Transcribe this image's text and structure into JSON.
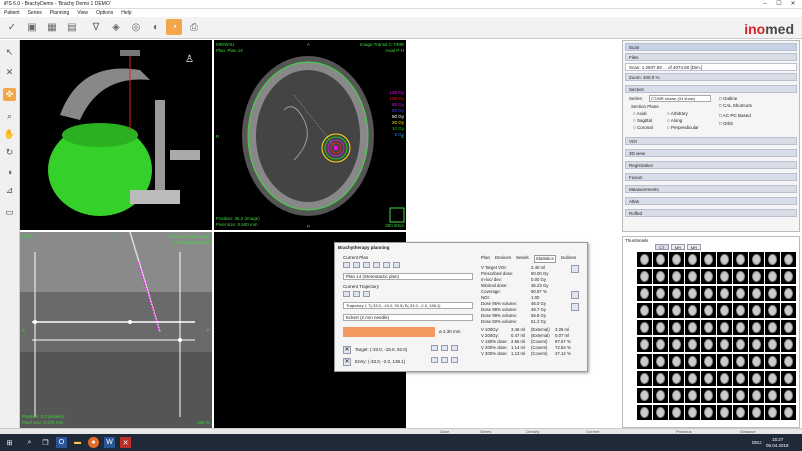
{
  "window": {
    "title": "iPS 6.0 - BrachyDemo - 'Brachy Demo 1 DEMO'"
  },
  "menu": [
    "Patient",
    "Series",
    "Planning",
    "View",
    "Options",
    "Help"
  ],
  "logo": {
    "part1": "ino",
    "part2": "med"
  },
  "views": {
    "axial": {
      "tl1": "MR/W4U",
      "tl2": "Plan: Plan 14",
      "tr1": "Image Transit C.T/MR",
      "tr2": "Axial P-H",
      "top_dir": "A",
      "bottom_dir": "P",
      "left_dir": "R",
      "right_dir": "L",
      "bl1": "Position: 35.2 (image)",
      "bl2": "Pixel size: 0.500 mm",
      "br": "250.0mm",
      "isodose": [
        "120 Gy",
        "100 Gy",
        "80 Gy",
        "60 Gy",
        "50 Gy",
        "20 Gy",
        "10 Gy",
        "5 Gy"
      ]
    },
    "sagittal": {
      "tl1": "CT/CT",
      "tl2": "",
      "tr1": "Screen Transit Angle",
      "tr2": "Left/Sagittal/Stack",
      "br": "400 %",
      "bl1": "Position: 0.0 (screen)",
      "bl2": "Pixel size: 0.375 mm",
      "top_dir": "S",
      "left_dir": "A",
      "right_dir": "P"
    }
  },
  "panel": {
    "rows": [
      "Files",
      "Scan: 1.2837.59 ... of 4074.60 [Dim.]",
      "Zoom: 400.0 %",
      "Section",
      "VOI",
      "3D view",
      "Registration",
      "Fusion",
      "Measurements",
      "Atlas",
      "Rolfed"
    ],
    "series_label": "Series:",
    "series_value": "CT/MR shown (31 show)",
    "section_plane": "Section Plane",
    "radios": [
      "Axial",
      "Sagittal",
      "Coronal",
      "Arbitrary",
      "Along",
      "Perpendicular"
    ],
    "checks": [
      "Outline",
      "CAL Shortcuts",
      "AC-PC Based",
      "Orbit"
    ]
  },
  "thumbs": {
    "title": "Thumbnails",
    "tabs": [
      "CT",
      "MR",
      "MR"
    ]
  },
  "dialog": {
    "title": "Brachytherapy planning",
    "current_plan": "Current Plan",
    "plan_value": "Plan 14 (Stereotactic plan)",
    "current_trajectory": "Current Trajectory",
    "trajectory_value": "Trajectory 1 T(-33.0, -19.0, 92.5) E(-33.0, -2.0, 138.1)",
    "needle": "Eckert (2 mm needle)",
    "needle_len": "ø 2.30 mm",
    "target": "Target: (-33.0, -19.0, 92.5)",
    "entry": "Entry: (-33.0, -2.0, 138.1)",
    "tabs": [
      "Plan",
      "Devices",
      "Seeds",
      "Statistics",
      "Isolines"
    ],
    "stats": [
      [
        "V Target VOI:",
        "2.40 ml"
      ],
      [
        "Prescribed dose:",
        "50.00 Gy"
      ],
      [
        "In-loc/ dev:",
        "0.00 Gy"
      ],
      [
        "Minimal dose:",
        "36.23 Gy"
      ],
      [
        "Coverage:",
        "90.87 %"
      ],
      [
        "NOI:",
        "1.00"
      ],
      [
        "Dose 95% volume:",
        "46.0 Gy"
      ],
      [
        "Dose 98% volume:",
        "49.7 Gy"
      ],
      [
        "Dose 99% volume:",
        "55.8 Gy"
      ],
      [
        "Dose 50% volume:",
        "61.2 Gy"
      ]
    ],
    "stats2": [
      [
        "V 100Gy:",
        "3.46 ml",
        "(External)",
        "3.26 ml"
      ],
      [
        "V 200Gy:",
        "0.47 ml",
        "(External)",
        "0.07 ml"
      ],
      [
        "V 150% dose:",
        "2.55 ml",
        "(Covers)",
        "97.57 %"
      ],
      [
        "V 200% dose:",
        "1.14 ml",
        "(Covers)",
        "72.84 %"
      ],
      [
        "V 300% dose:",
        "1.13 ml",
        "(Covers)",
        "47.12 %"
      ]
    ]
  },
  "status": [
    "Dose",
    "Series",
    "Density",
    "Current",
    "Previous",
    "Distance"
  ],
  "taskbar": {
    "time": "15:27",
    "date": "06.04.2018",
    "lang": "DEU"
  }
}
